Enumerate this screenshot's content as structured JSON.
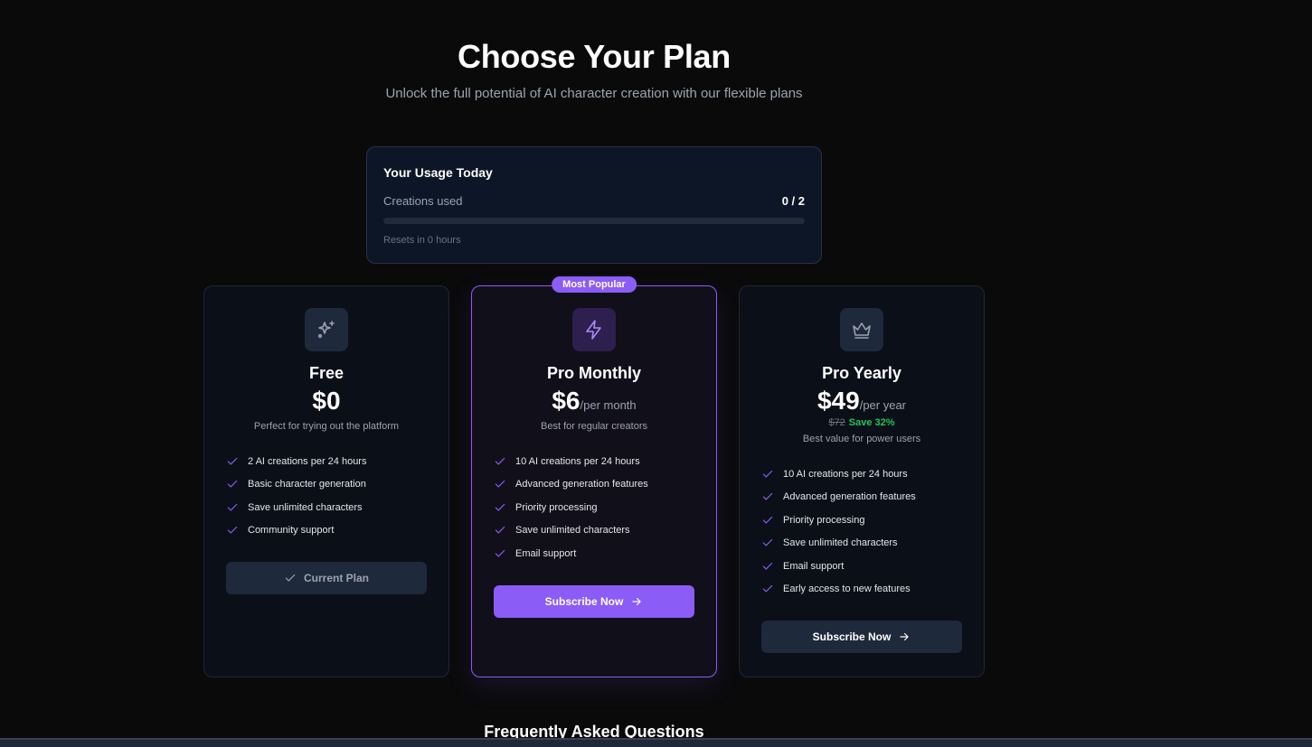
{
  "header": {
    "title": "Choose Your Plan",
    "subtitle": "Unlock the full potential of AI character creation with our flexible plans"
  },
  "usage": {
    "title": "Your Usage Today",
    "label": "Creations used",
    "value": "0 / 2",
    "progress_fraction": 0,
    "reset": "Resets in 0 hours"
  },
  "plans": [
    {
      "icon": "sparkles-icon",
      "name": "Free",
      "price": "$0",
      "period": "",
      "description": "Perfect for trying out the platform",
      "features": [
        "2 AI creations per 24 hours",
        "Basic character generation",
        "Save unlimited characters",
        "Community support"
      ],
      "button": "Current Plan"
    },
    {
      "badge": "Most Popular",
      "icon": "lightning-icon",
      "name": "Pro Monthly",
      "price": "$6",
      "period": "/per month",
      "description": "Best for regular creators",
      "features": [
        "10 AI creations per 24 hours",
        "Advanced generation features",
        "Priority processing",
        "Save unlimited characters",
        "Email support"
      ],
      "button": "Subscribe Now"
    },
    {
      "icon": "crown-icon",
      "name": "Pro Yearly",
      "price": "$49",
      "period": "/per year",
      "old_price": "$72",
      "save": "Save 32%",
      "description": "Best value for power users",
      "features": [
        "10 AI creations per 24 hours",
        "Advanced generation features",
        "Priority processing",
        "Save unlimited characters",
        "Email support",
        "Early access to new features"
      ],
      "button": "Subscribe Now"
    }
  ],
  "faq": {
    "title": "Frequently Asked Questions"
  },
  "colors": {
    "accent": "#8b5cf6",
    "save": "#22c55e",
    "background": "#0a0a0b"
  }
}
